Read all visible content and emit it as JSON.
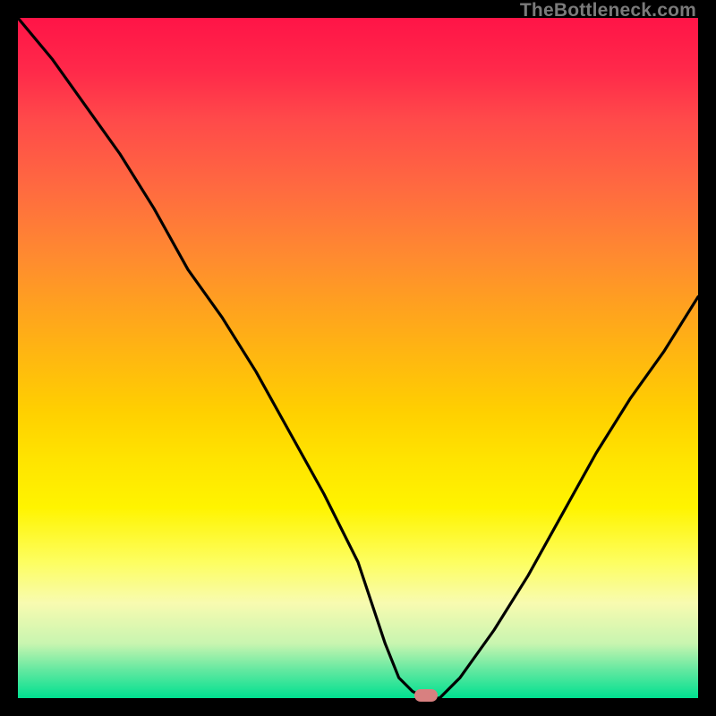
{
  "watermark": "TheBottleneck.com",
  "colors": {
    "page_bg": "#000000",
    "curve_stroke": "#000000",
    "marker_fill": "#d88080",
    "gradient_top": "#ff1447",
    "gradient_bottom": "#00e090"
  },
  "chart_data": {
    "type": "line",
    "title": "",
    "xlabel": "",
    "ylabel": "",
    "xlim": [
      0,
      100
    ],
    "ylim": [
      0,
      100
    ],
    "grid": false,
    "series": [
      {
        "name": "bottleneck-curve",
        "x": [
          0,
          5,
          10,
          15,
          20,
          25,
          30,
          35,
          40,
          45,
          50,
          52,
          54,
          56,
          58,
          60,
          62,
          65,
          70,
          75,
          80,
          85,
          90,
          95,
          100
        ],
        "y": [
          100,
          94,
          87,
          80,
          72,
          63,
          56,
          48,
          39,
          30,
          20,
          14,
          8,
          3,
          1,
          0,
          0,
          3,
          10,
          18,
          27,
          36,
          44,
          51,
          59
        ]
      }
    ],
    "marker": {
      "x": 60,
      "y": 0
    },
    "legend": false
  }
}
